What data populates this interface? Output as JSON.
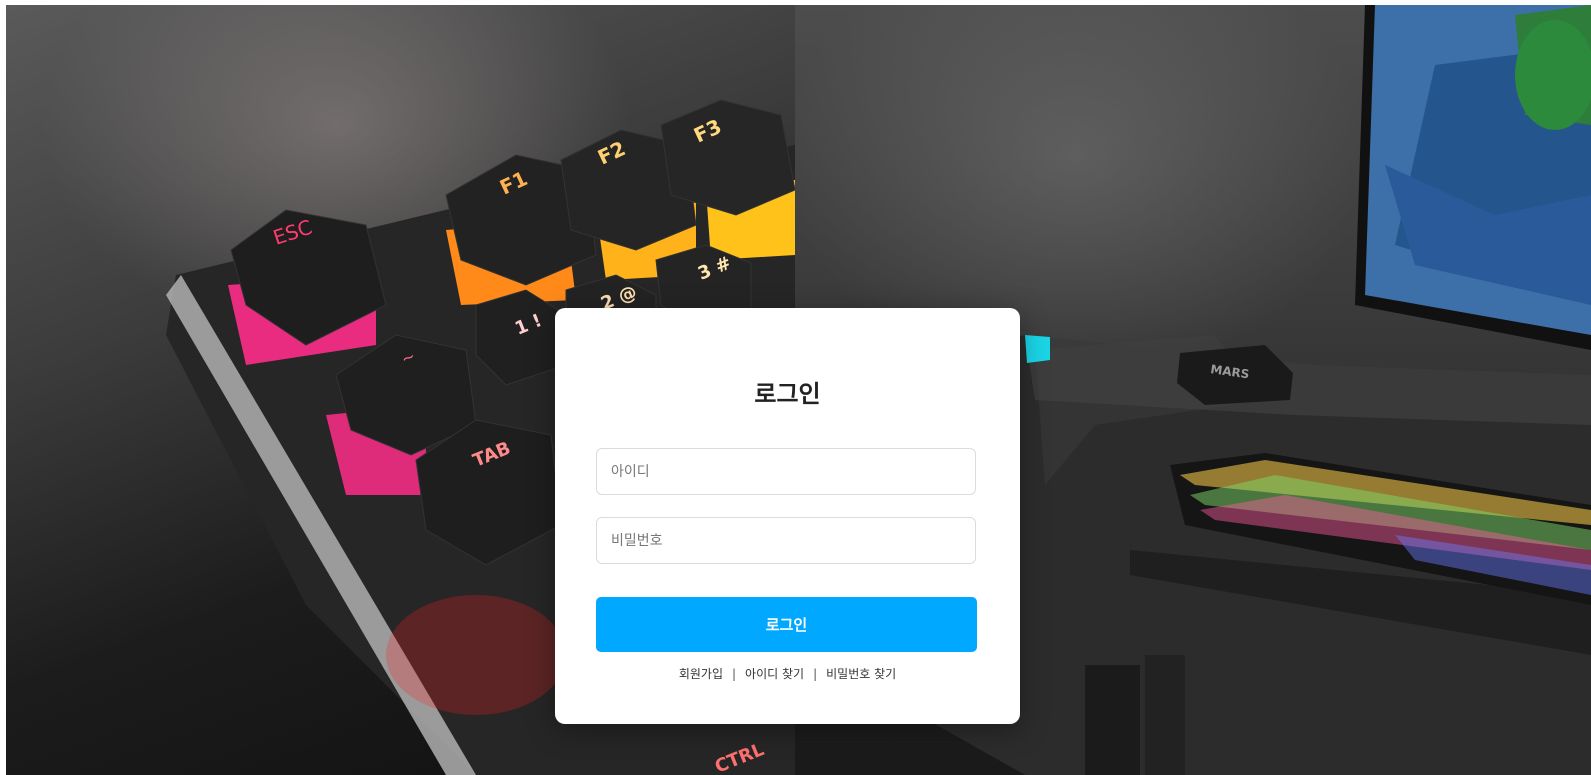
{
  "login": {
    "title": "로그인",
    "id_placeholder": "아이디",
    "password_placeholder": "비밀번호",
    "submit_label": "로그인",
    "links": {
      "signup": "회원가입",
      "find_id": "아이디 찾기",
      "find_password": "비밀번호 찾기",
      "separator": "|"
    }
  },
  "background": {
    "left_keycaps": [
      "ESC",
      "F1",
      "F2",
      "F3",
      "TAB",
      "1 !",
      "2 @",
      "3 #",
      "~",
      "CTRL"
    ],
    "right_brand": "MARS"
  },
  "colors": {
    "accent": "#00a8ff",
    "glow_pink": "#ff2d8a",
    "glow_orange": "#ff8a1a",
    "glow_yellow": "#ffc21a",
    "glow_cyan": "#1ad5e6"
  }
}
